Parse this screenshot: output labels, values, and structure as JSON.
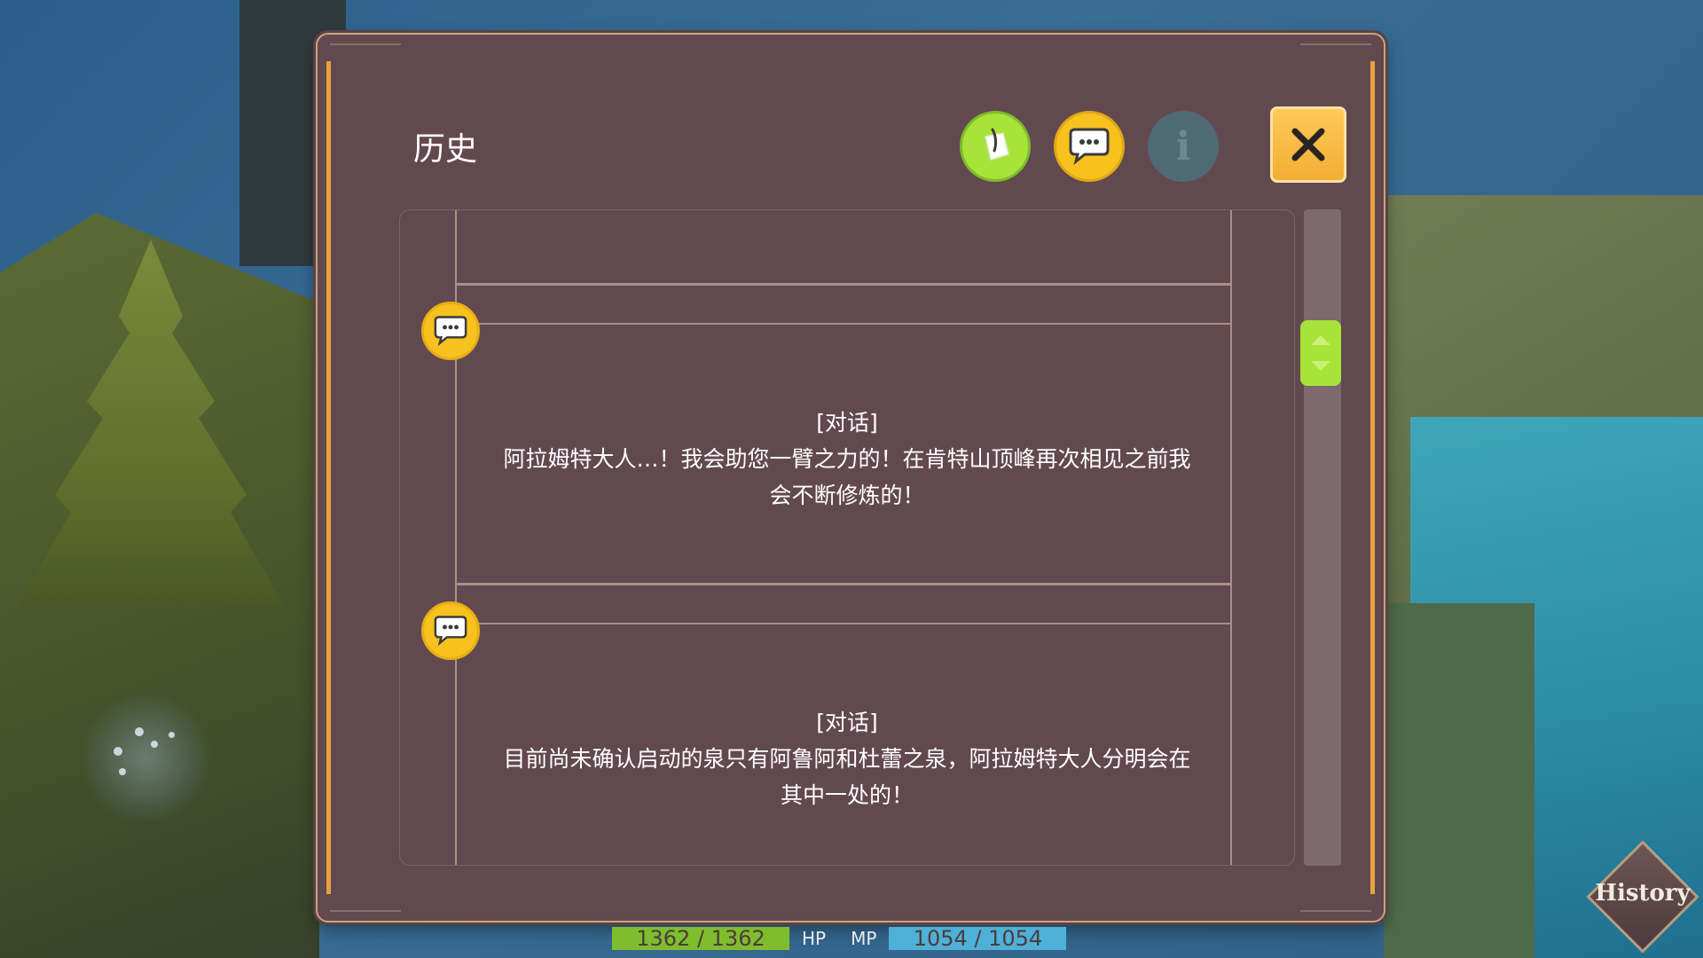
{
  "window": {
    "title": "历史",
    "tabs": [
      {
        "icon": "quill-note-icon",
        "state": "active"
      },
      {
        "icon": "speech-bubble-icon",
        "state": "normal"
      },
      {
        "icon": "info-icon",
        "label": "i",
        "state": "disabled"
      }
    ],
    "close_icon": "close-x-icon"
  },
  "entries": [
    {
      "icon": "speech-bubble-icon",
      "tag": "[对话]",
      "line1": "阿拉姆特大人…！我会助您一臂之力的！在肯特山顶峰再次相见之前我",
      "line2": "会不断修炼的！"
    },
    {
      "icon": "speech-bubble-icon",
      "tag": "[对话]",
      "line1": "目前尚未确认启动的泉只有阿鲁阿和杜蕾之泉，阿拉姆特大人分明会在",
      "line2": "其中一处的！"
    }
  ],
  "status": {
    "hp_value": "1362 / 1362",
    "hp_label": "HP",
    "mp_label": "MP",
    "mp_value": "1054 / 1054"
  },
  "history_button": {
    "label": "History"
  },
  "colors": {
    "panel": "#62494f",
    "frame": "#c9a57a",
    "accent_orange": "#e9a13b",
    "green": "#a8e33a",
    "yellow": "#f7c21e"
  }
}
